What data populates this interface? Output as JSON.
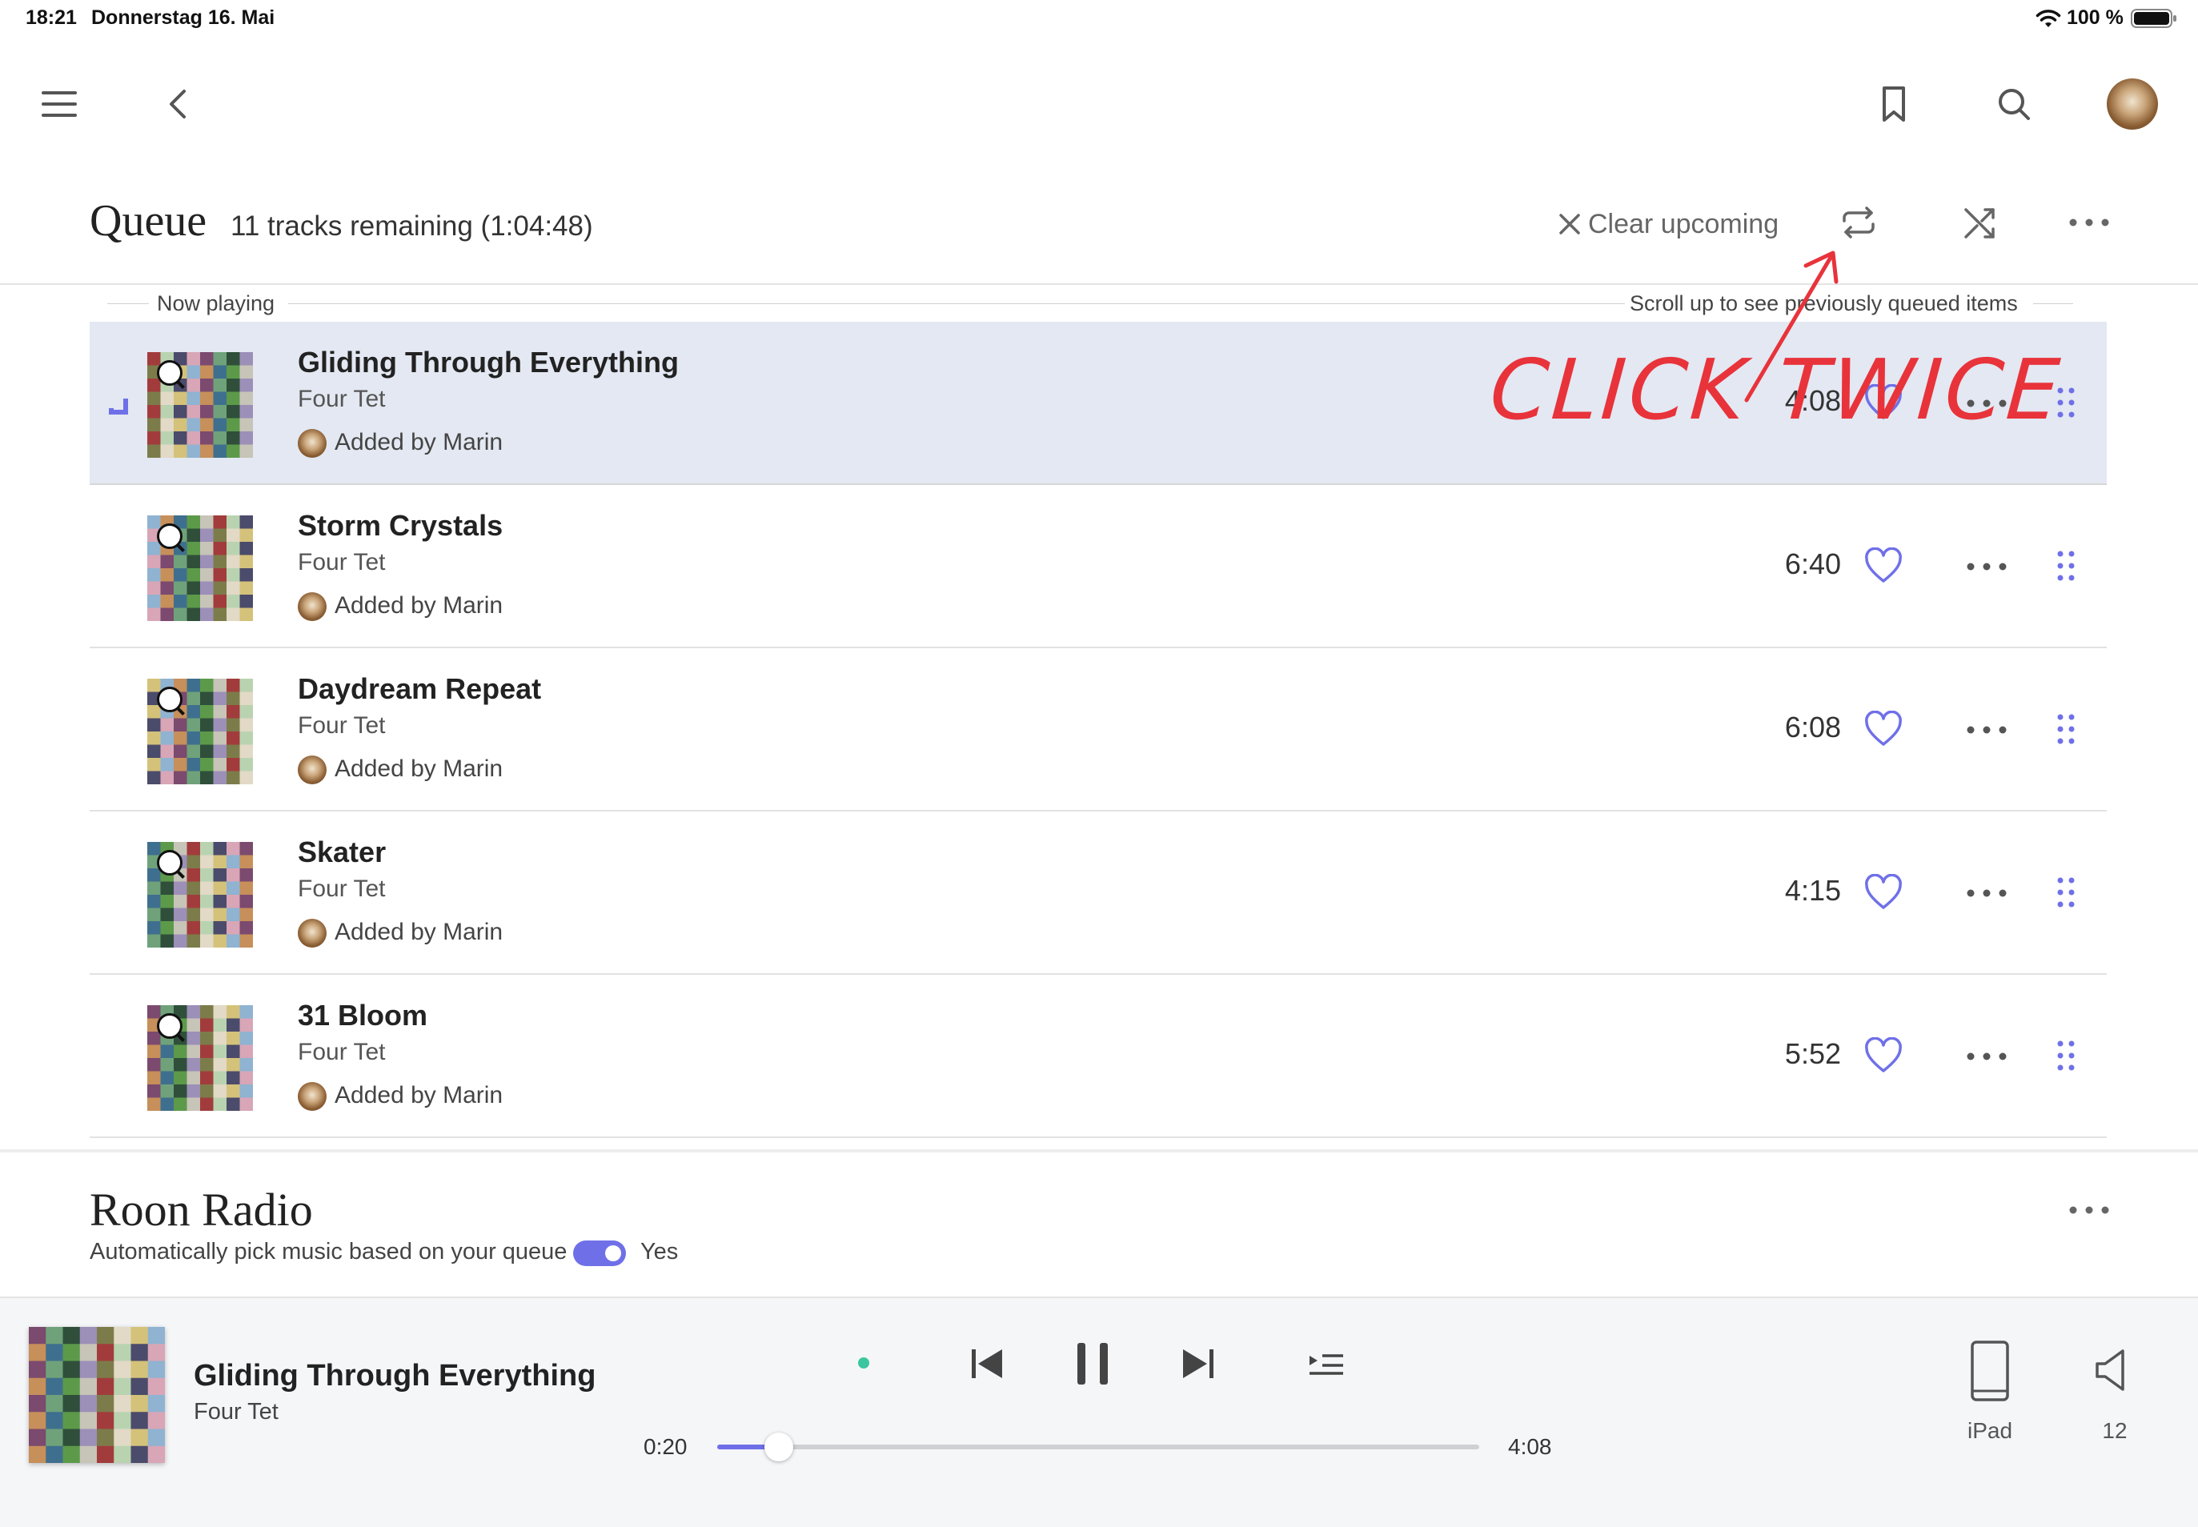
{
  "status_bar": {
    "time": "18:21",
    "date": "Donnerstag 16. Mai",
    "battery_percent": "100 %"
  },
  "nav": {
    "menu_icon": "hamburger-menu-icon",
    "back_icon": "chevron-left-icon",
    "bookmark_icon": "bookmark-icon",
    "search_icon": "search-icon",
    "avatar": "user-avatar"
  },
  "queue": {
    "title": "Queue",
    "subtitle": "11 tracks remaining (1:04:48)",
    "clear_label": "Clear upcoming",
    "now_playing_label": "Now playing",
    "scroll_hint": "Scroll up to see previously queued items",
    "tracks": [
      {
        "title": "Gliding Through Everything",
        "artist": "Four Tet",
        "added_by": "Added by Marin",
        "duration": "4:08",
        "current": true
      },
      {
        "title": "Storm Crystals",
        "artist": "Four Tet",
        "added_by": "Added by Marin",
        "duration": "6:40",
        "current": false
      },
      {
        "title": "Daydream Repeat",
        "artist": "Four Tet",
        "added_by": "Added by Marin",
        "duration": "6:08",
        "current": false
      },
      {
        "title": "Skater",
        "artist": "Four Tet",
        "added_by": "Added by Marin",
        "duration": "4:15",
        "current": false
      },
      {
        "title": "31 Bloom",
        "artist": "Four Tet",
        "added_by": "Added by Marin",
        "duration": "5:52",
        "current": false
      }
    ]
  },
  "radio": {
    "title": "Roon Radio",
    "description": "Automatically pick music based on your queue",
    "toggle_label": "Yes",
    "enabled": true
  },
  "player": {
    "title": "Gliding Through Everything",
    "artist": "Four Tet",
    "elapsed": "0:20",
    "total": "4:08",
    "progress": 0.0806,
    "device_label": "iPad",
    "volume_label": "12"
  },
  "annotation": {
    "text": "CLICK TWICE"
  },
  "colors": {
    "accent": "#6f70e8",
    "current_row_bg": "#e3e8f2",
    "annotation": "#e8333b",
    "status_dot": "#3cc6a0"
  }
}
